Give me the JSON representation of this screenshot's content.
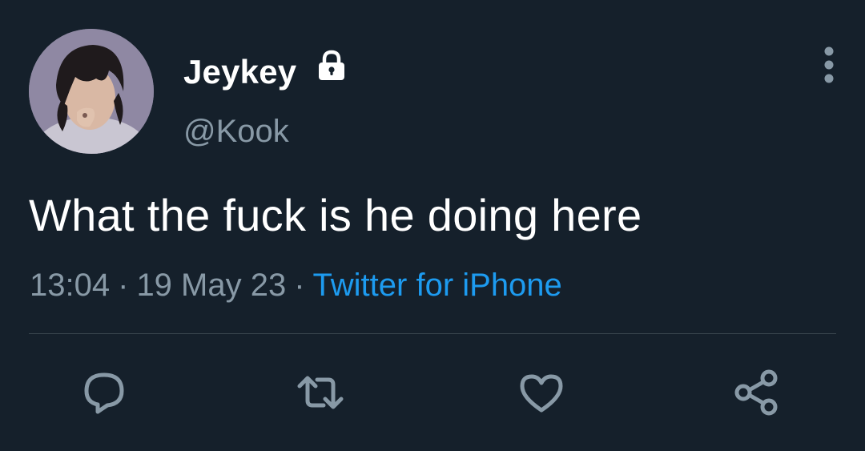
{
  "author": {
    "display_name": "Jeykey",
    "handle": "@Kook",
    "protected": true
  },
  "tweet": {
    "text": "What the fuck is he doing here",
    "time": "13:04",
    "separator": "·",
    "date": "19 May 23",
    "source": "Twitter for iPhone"
  },
  "icons": {
    "lock": "lock-icon",
    "more": "more-vertical-icon",
    "reply": "reply-icon",
    "retweet": "retweet-icon",
    "like": "like-heart-icon",
    "share": "share-icon"
  },
  "colors": {
    "background": "#15202b",
    "text_primary": "#ffffff",
    "text_secondary": "#8899a6",
    "link": "#1d9bf0",
    "divider": "#38444d"
  }
}
